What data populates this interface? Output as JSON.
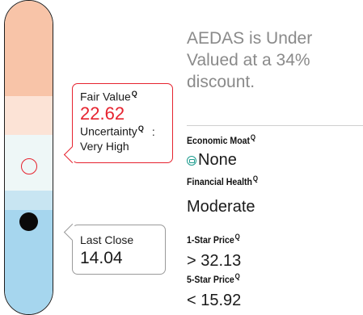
{
  "rating_bar": {
    "bands": [
      {
        "name": "band-1",
        "color": "#f8c4a8"
      },
      {
        "name": "band-2",
        "color": "#fce3d6"
      },
      {
        "name": "band-3",
        "color": "#eef7f7"
      },
      {
        "name": "band-4",
        "color": "#c8e5f2"
      },
      {
        "name": "band-5",
        "color": "#a6d6ee"
      }
    ]
  },
  "fair_value": {
    "label": "Fair Value",
    "value": "22.62",
    "uncertainty_label": "Uncertainty",
    "separator": ":",
    "uncertainty_value": "Very High",
    "accent_color": "#e6232f"
  },
  "last_close": {
    "label": "Last Close",
    "value": "14.04"
  },
  "summary": {
    "headline": "AEDAS is Under Valued at a 34% discount."
  },
  "economic_moat": {
    "label": "Economic Moat",
    "icon": "moat-none-icon",
    "value": "None"
  },
  "financial_health": {
    "label": "Financial Health",
    "value": "Moderate"
  },
  "one_star": {
    "label": "1-Star Price",
    "comparator": ">",
    "value": "32.13"
  },
  "five_star": {
    "label": "5-Star Price",
    "comparator": "<",
    "value": "15.92"
  },
  "info_icon_glyph": "Q"
}
